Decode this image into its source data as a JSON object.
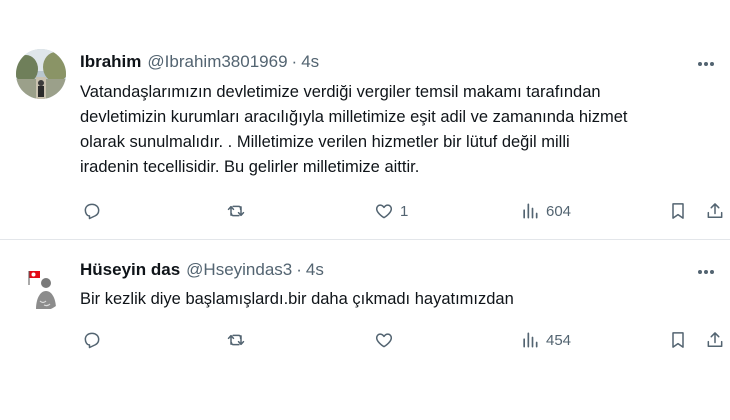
{
  "tweets": [
    {
      "name": "Ibrahim",
      "handle": "@Ibrahim3801969",
      "separator": "·",
      "time": "4s",
      "text_lines": [
        "Vatandaşlarımızın devletimize verdiği vergiler  temsil makamı tarafından",
        "devletimizin kurumları aracılığıyla milletimize eşit adil ve zamanında hizmet",
        "olarak sunulmalıdır. . Milletimize verilen hizmetler bir lütuf değil milli",
        "iradenin tecellisidir. Bu gelirler milletimize aittir."
      ],
      "likes": "1",
      "views": "604"
    },
    {
      "name": "Hüseyin das",
      "handle": "@Hseyindas3",
      "separator": "·",
      "time": "4s",
      "text_lines": [
        "Bir kezlik diye başlamışlardı.bir daha çıkmadı hayatımızdan"
      ],
      "likes": "",
      "views": "454"
    }
  ],
  "icons": [
    "more-icon",
    "reply-icon",
    "retweet-icon",
    "like-icon",
    "views-icon",
    "bookmark-icon",
    "share-icon"
  ],
  "colors": {
    "text": "#0f1419",
    "secondary": "#536471",
    "divider": "#e3e6ea"
  }
}
